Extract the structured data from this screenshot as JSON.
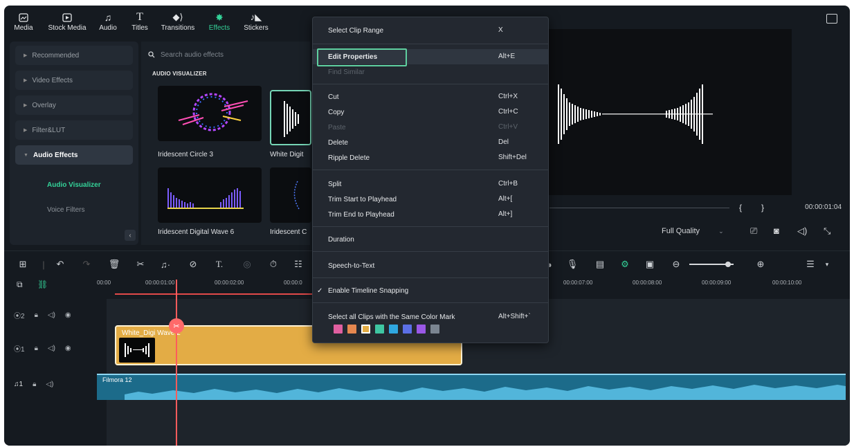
{
  "toolbar": {
    "items": [
      {
        "label": "Media",
        "icon": "media-icon"
      },
      {
        "label": "Stock Media",
        "icon": "stock-media-icon"
      },
      {
        "label": "Audio",
        "icon": "music-note-icon"
      },
      {
        "label": "Titles",
        "icon": "titles-icon"
      },
      {
        "label": "Transitions",
        "icon": "transitions-icon"
      },
      {
        "label": "Effects",
        "icon": "effects-icon",
        "active": true
      },
      {
        "label": "Stickers",
        "icon": "stickers-icon"
      }
    ]
  },
  "sidebar": {
    "categories": [
      {
        "label": "Recommended"
      },
      {
        "label": "Video Effects"
      },
      {
        "label": "Overlay"
      },
      {
        "label": "Filter&LUT"
      },
      {
        "label": "Audio Effects",
        "open": true
      }
    ],
    "subitems": [
      {
        "label": "Audio Visualizer",
        "active": true
      },
      {
        "label": "Voice Filters"
      }
    ]
  },
  "browser": {
    "search_placeholder": "Search audio effects",
    "section_title": "AUDIO VISUALIZER",
    "items": [
      {
        "label": "Iridescent Circle 3"
      },
      {
        "label": "White Digit"
      },
      {
        "label": "Iridescent Digital Wave 6"
      },
      {
        "label": "Iridescent C"
      }
    ]
  },
  "preview": {
    "timecode": "00:00:01:04",
    "quality": "Full Quality"
  },
  "timeline": {
    "ruler_marks": [
      "00:00",
      "00:00:01:00",
      "00:00:02:00",
      "00:00:0",
      "00:00:07:00",
      "00:00:08:00",
      "00:00:09:00",
      "00:00:10:00"
    ],
    "video_clip_label": "White_Digi  Wave 2",
    "audio_clip_label": "Filmora 12",
    "track_numbers": [
      "2",
      "1",
      "1"
    ]
  },
  "context_menu": {
    "items": [
      {
        "label": "Select Clip Range",
        "shortcut": "X"
      },
      {
        "label": "Edit Properties",
        "shortcut": "Alt+E",
        "highlighted": true
      },
      {
        "label": "Find Similar",
        "shortcut": "",
        "disabled": true
      },
      {
        "label": "Cut",
        "shortcut": "Ctrl+X"
      },
      {
        "label": "Copy",
        "shortcut": "Ctrl+C"
      },
      {
        "label": "Paste",
        "shortcut": "Ctrl+V",
        "disabled": true
      },
      {
        "label": "Delete",
        "shortcut": "Del"
      },
      {
        "label": "Ripple Delete",
        "shortcut": "Shift+Del"
      },
      {
        "label": "Split",
        "shortcut": "Ctrl+B"
      },
      {
        "label": "Trim Start to Playhead",
        "shortcut": "Alt+["
      },
      {
        "label": "Trim End to Playhead",
        "shortcut": "Alt+]"
      },
      {
        "label": "Duration",
        "shortcut": ""
      },
      {
        "label": "Speech-to-Text",
        "shortcut": ""
      },
      {
        "label": "Enable Timeline Snapping",
        "shortcut": "",
        "checked": true
      },
      {
        "label": "Select all Clips with the Same Color Mark",
        "shortcut": "Alt+Shift+`"
      }
    ],
    "color_marks": [
      "#e05fa0",
      "#e5874f",
      "#e3ac45",
      "#3fc6a2",
      "#2fa7e0",
      "#5b6fe6",
      "#9a58e6",
      "#7b8591"
    ]
  }
}
